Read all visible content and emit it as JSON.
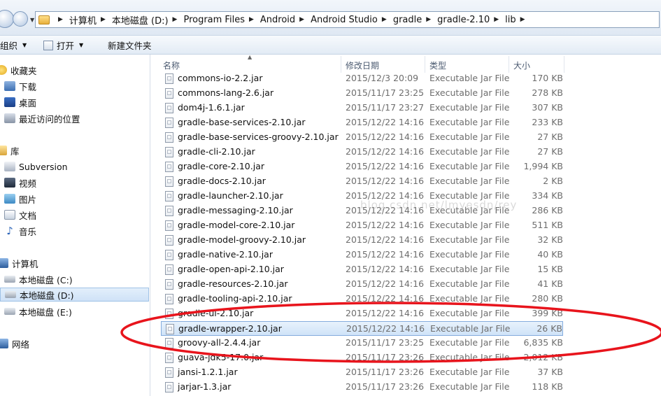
{
  "address": {
    "breadcrumbs": [
      "计算机",
      "本地磁盘 (D:)",
      "Program Files",
      "Android",
      "Android Studio",
      "gradle",
      "gradle-2.10",
      "lib"
    ]
  },
  "toolbar": {
    "organize": "组织",
    "open": "打开",
    "new_folder": "新建文件夹"
  },
  "nav": {
    "favorites": "收藏夹",
    "downloads": "下载",
    "desktop": "桌面",
    "recent": "最近访问的位置",
    "libraries": "库",
    "subversion": "Subversion",
    "videos": "视频",
    "pictures": "图片",
    "documents": "文档",
    "music": "音乐",
    "computer": "计算机",
    "drive_c": "本地磁盘 (C:)",
    "drive_d": "本地磁盘 (D:)",
    "drive_e": "本地磁盘 (E:)",
    "network": "网络"
  },
  "columns": {
    "name": "名称",
    "date": "修改日期",
    "type": "类型",
    "size": "大小"
  },
  "files": [
    {
      "name": "commons-io-2.2.jar",
      "date": "2015/12/3 20:09",
      "type": "Executable Jar File",
      "size": "170 KB"
    },
    {
      "name": "commons-lang-2.6.jar",
      "date": "2015/11/17 23:25",
      "type": "Executable Jar File",
      "size": "278 KB"
    },
    {
      "name": "dom4j-1.6.1.jar",
      "date": "2015/11/17 23:27",
      "type": "Executable Jar File",
      "size": "307 KB"
    },
    {
      "name": "gradle-base-services-2.10.jar",
      "date": "2015/12/22 14:16",
      "type": "Executable Jar File",
      "size": "233 KB"
    },
    {
      "name": "gradle-base-services-groovy-2.10.jar",
      "date": "2015/12/22 14:16",
      "type": "Executable Jar File",
      "size": "27 KB"
    },
    {
      "name": "gradle-cli-2.10.jar",
      "date": "2015/12/22 14:16",
      "type": "Executable Jar File",
      "size": "27 KB"
    },
    {
      "name": "gradle-core-2.10.jar",
      "date": "2015/12/22 14:16",
      "type": "Executable Jar File",
      "size": "1,994 KB"
    },
    {
      "name": "gradle-docs-2.10.jar",
      "date": "2015/12/22 14:16",
      "type": "Executable Jar File",
      "size": "2 KB"
    },
    {
      "name": "gradle-launcher-2.10.jar",
      "date": "2015/12/22 14:16",
      "type": "Executable Jar File",
      "size": "334 KB"
    },
    {
      "name": "gradle-messaging-2.10.jar",
      "date": "2015/12/22 14:16",
      "type": "Executable Jar File",
      "size": "286 KB"
    },
    {
      "name": "gradle-model-core-2.10.jar",
      "date": "2015/12/22 14:16",
      "type": "Executable Jar File",
      "size": "511 KB"
    },
    {
      "name": "gradle-model-groovy-2.10.jar",
      "date": "2015/12/22 14:16",
      "type": "Executable Jar File",
      "size": "32 KB"
    },
    {
      "name": "gradle-native-2.10.jar",
      "date": "2015/12/22 14:16",
      "type": "Executable Jar File",
      "size": "40 KB"
    },
    {
      "name": "gradle-open-api-2.10.jar",
      "date": "2015/12/22 14:16",
      "type": "Executable Jar File",
      "size": "15 KB"
    },
    {
      "name": "gradle-resources-2.10.jar",
      "date": "2015/12/22 14:16",
      "type": "Executable Jar File",
      "size": "41 KB"
    },
    {
      "name": "gradle-tooling-api-2.10.jar",
      "date": "2015/12/22 14:16",
      "type": "Executable Jar File",
      "size": "280 KB"
    },
    {
      "name": "gradle-ui-2.10.jar",
      "date": "2015/12/22 14:16",
      "type": "Executable Jar File",
      "size": "399 KB"
    },
    {
      "name": "gradle-wrapper-2.10.jar",
      "date": "2015/12/22 14:16",
      "type": "Executable Jar File",
      "size": "26 KB"
    },
    {
      "name": "groovy-all-2.4.4.jar",
      "date": "2015/11/17 23:25",
      "type": "Executable Jar File",
      "size": "6,835 KB"
    },
    {
      "name": "guava-jdk5-17.0.jar",
      "date": "2015/11/17 23:26",
      "type": "Executable Jar File",
      "size": "2,012 KB"
    },
    {
      "name": "jansi-1.2.1.jar",
      "date": "2015/11/17 23:26",
      "type": "Executable Jar File",
      "size": "37 KB"
    },
    {
      "name": "jarjar-1.3.jar",
      "date": "2015/11/17 23:26",
      "type": "Executable Jar File",
      "size": "118 KB"
    }
  ],
  "selected_file": "gradle-wrapper-2.10.jar",
  "watermark": "blog.csdn.net/lmyesdn/rey",
  "colors": {
    "highlight_circle": "#e8141c",
    "selection": "#cfe3f8"
  }
}
